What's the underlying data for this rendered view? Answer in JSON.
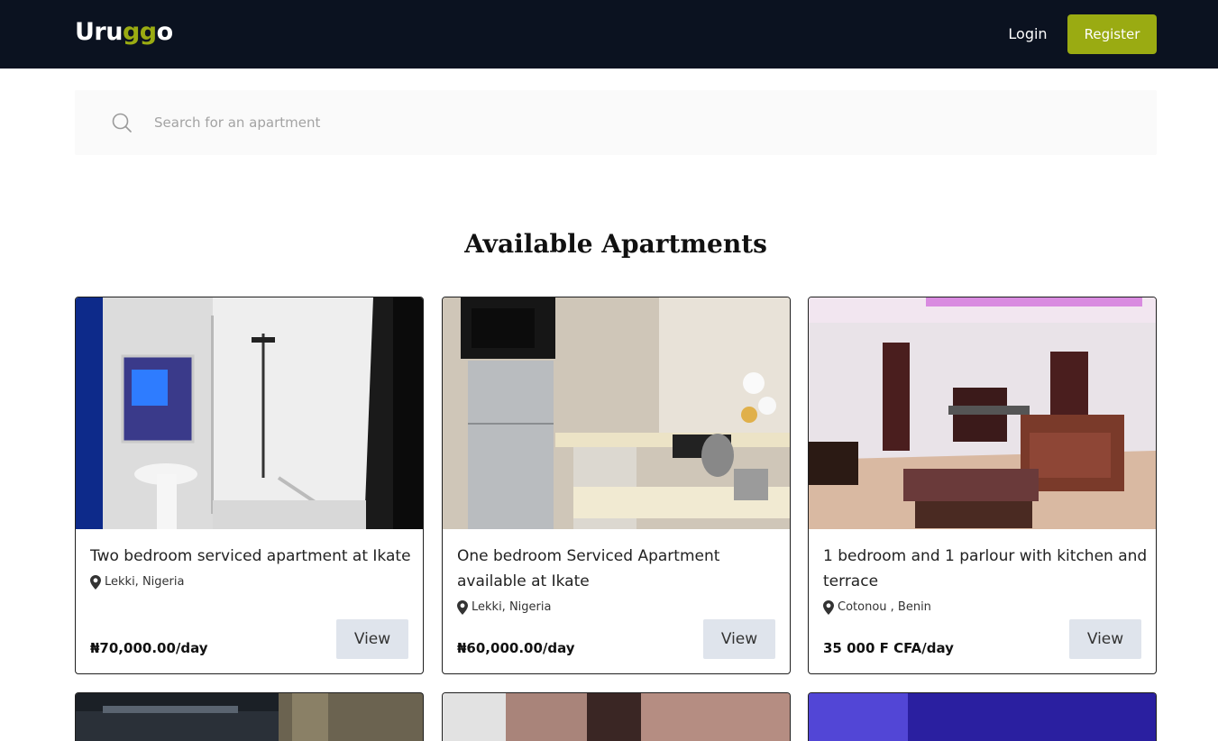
{
  "nav": {
    "logo_main": "Uru",
    "logo_accent": "gg",
    "logo_tail": "o",
    "login_label": "Login",
    "register_label": "Register"
  },
  "search": {
    "placeholder": "Search for an apartment",
    "value": ""
  },
  "section_title": "Available Apartments",
  "listings": [
    {
      "title": "Two bedroom serviced apartment at Ikate",
      "location": "Lekki, Nigeria",
      "price": "₦70,000.00/day",
      "view_label": "View"
    },
    {
      "title": "One bedroom Serviced Apartment available at Ikate",
      "location": "Lekki, Nigeria",
      "price": "₦60,000.00/day",
      "view_label": "View"
    },
    {
      "title": "1 bedroom and 1 parlour with kitchen and terrace",
      "location": "Cotonou , Benin",
      "price": "35 000 F CFA/day",
      "view_label": "View"
    }
  ],
  "icons": {
    "search": "search-icon",
    "location": "location-pin-icon"
  },
  "colors": {
    "navbar_bg": "#0b1220",
    "brand_accent": "#9aab12",
    "view_button_bg": "#dfe4ec"
  }
}
